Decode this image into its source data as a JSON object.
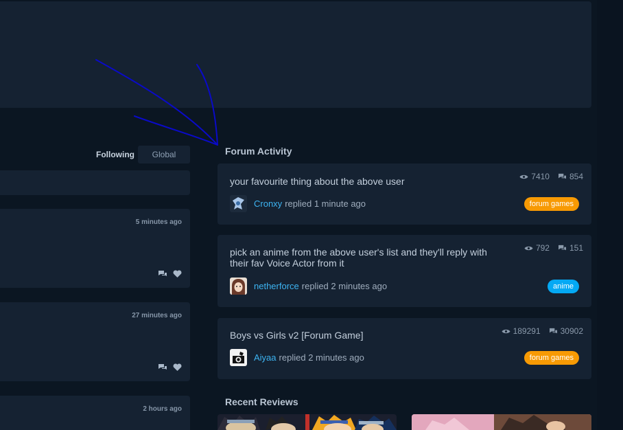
{
  "feed": {
    "tabs": {
      "following": "Following",
      "global": "Global"
    },
    "items": [
      {
        "time": "5 minutes ago"
      },
      {
        "time": "27 minutes ago"
      },
      {
        "time": "2 hours ago"
      }
    ]
  },
  "forum": {
    "title": "Forum Activity",
    "replied_word": "replied",
    "threads": [
      {
        "title": "your favourite thing about the above user",
        "views": "7410",
        "replies": "854",
        "user": "Cronxy",
        "time": "1 minute ago",
        "tag": "forum games",
        "tag_color": "#f79a04"
      },
      {
        "title": "pick an anime from the above user's list and they'll reply with their fav Voice Actor from it",
        "views": "792",
        "replies": "151",
        "user": "netherforce",
        "time": "2 minutes ago",
        "tag": "anime",
        "tag_color": "#04a9f4"
      },
      {
        "title": "Boys vs Girls v2 [Forum Game]",
        "views": "189291",
        "replies": "30902",
        "user": "Aiyaa",
        "time": "2 minutes ago",
        "tag": "forum games",
        "tag_color": "#f79a04"
      }
    ]
  },
  "reviews": {
    "title": "Recent Reviews"
  },
  "colors": {
    "background": "#0b1622",
    "card": "#152232",
    "link": "#3db4f2",
    "annotation": "#0a0ac8"
  }
}
